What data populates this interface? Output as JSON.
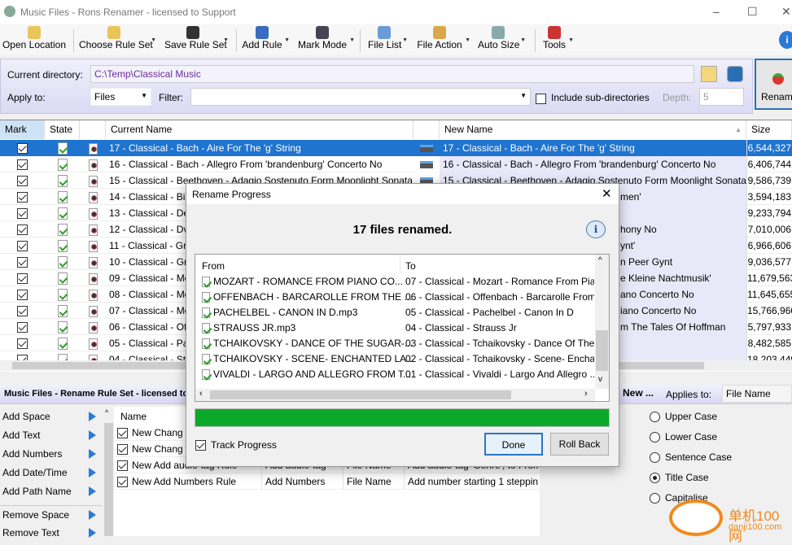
{
  "window": {
    "title": "Music Files - Rons Renamer - licensed to Support",
    "minimize": "–",
    "maximize": "☐",
    "close": "✕"
  },
  "toolbar": [
    {
      "label": "Open Location",
      "icon": "folder-icon",
      "color": "#e8c45a"
    },
    {
      "label": "Choose Rule Set",
      "icon": "folder-add-icon",
      "color": "#e8c45a"
    },
    {
      "label": "Save Rule Set",
      "icon": "save-icon",
      "color": "#333"
    },
    {
      "label": "Add Rule",
      "icon": "add-rule-icon",
      "color": "#3a6cc0"
    },
    {
      "label": "Mark Mode",
      "icon": "list-icon",
      "color": "#445"
    },
    {
      "label": "File List",
      "icon": "file-list-icon",
      "color": "#6a9ad8"
    },
    {
      "label": "File Action",
      "icon": "file-action-icon",
      "color": "#d8a84a"
    },
    {
      "label": "Auto Size",
      "icon": "auto-size-icon",
      "color": "#8aa"
    },
    {
      "label": "Tools",
      "icon": "tools-icon",
      "color": "#c33"
    }
  ],
  "directory": {
    "label": "Current directory:",
    "value": "C:\\Temp\\Classical Music",
    "apply_label": "Apply to:",
    "apply_value": "Files",
    "filter_label": "Filter:",
    "filter_value": "",
    "include_sub": "Include sub-directories",
    "depth_label": "Depth:",
    "depth_value": "5",
    "rename": "Renam"
  },
  "grid": {
    "headers": {
      "mark": "Mark",
      "state": "State",
      "current": "Current Name",
      "new": "New Name",
      "size": "Size"
    },
    "rows": [
      {
        "current": "17 - Classical - Bach - Aire For The 'g' String",
        "new": "17 - Classical - Bach - Aire For The 'g' String",
        "size": "6,544,327"
      },
      {
        "current": "16 - Classical - Bach - Allegro From 'brandenburg' Concerto No",
        "new": "16 - Classical - Bach - Allegro From 'brandenburg' Concerto No",
        "size": "6,406,744"
      },
      {
        "current": "15 - Classical - Beethoven - Adagio Sostenuto Form Moonlight Sonata",
        "new": "15 - Classical - Beethoven - Adagio Sostenuto Form Moonlight Sonata",
        "size": "9,586,739"
      },
      {
        "current": "14 - Classical - Biz",
        "new_fragment": "men'",
        "size": "3,594,183"
      },
      {
        "current": "13 - Classical - De",
        "new_fragment": "",
        "size": "9,233,794"
      },
      {
        "current": "12 - Classical - Dv",
        "new_fragment": "hony No",
        "size": "7,010,006"
      },
      {
        "current": "11 - Classical - Gri",
        "new_fragment": "ynt'",
        "size": "6,966,606"
      },
      {
        "current": "10 - Classical - Gri",
        "new_fragment": "n Peer Gynt",
        "size": "9,036,577"
      },
      {
        "current": "09 - Classical - Mo",
        "new_fragment": "e Kleine Nachtmusik'",
        "size": "11,679,563"
      },
      {
        "current": "08 - Classical - Mo",
        "new_fragment": "ano Concerto No",
        "size": "11,645,655"
      },
      {
        "current": "07 - Classical - Mo",
        "new_fragment": "iano Concerto No",
        "size": "15,766,960"
      },
      {
        "current": "06 - Classical - Off",
        "new_fragment": "m The Tales Of Hoffman",
        "size": "5,797,933"
      },
      {
        "current": "05 - Classical - Pa",
        "new_fragment": "",
        "size": "8,482,585"
      },
      {
        "current": "04 - Classical - Str",
        "new_fragment": "",
        "size": "18,203,449"
      }
    ]
  },
  "ruleset": {
    "title": "Music Files - Rename Rule Set - licensed to",
    "new_label": "New ...",
    "applies_label": "Applies to:",
    "applies_value": "File Name",
    "actions": [
      "Add Space",
      "Add Text",
      "Add Numbers",
      "Add Date/Time",
      "Add Path Name",
      "Remove Space",
      "Remove Text"
    ],
    "table_header": "Name",
    "rules": [
      {
        "name": "New Chang",
        "type": "",
        "applies": "",
        "desc": ""
      },
      {
        "name": "New Chang",
        "type": "",
        "applies": "",
        "desc": ""
      },
      {
        "name": "New Add audio-tag Rule",
        "type": "Add audio-tag",
        "applies": "File Name",
        "desc": "Add audio-tag 'Genre', to From"
      },
      {
        "name": "New Add Numbers Rule",
        "type": "Add Numbers",
        "applies": "File Name",
        "desc": "Add number starting 1 steppin"
      }
    ],
    "case_options": [
      {
        "label": "Upper Case",
        "selected": false
      },
      {
        "label": "Lower Case",
        "selected": false
      },
      {
        "label": "Sentence Case",
        "selected": false
      },
      {
        "label": "Title Case",
        "selected": true
      },
      {
        "label": "Capitalise",
        "selected": false
      }
    ]
  },
  "dialog": {
    "title": "Rename Progress",
    "close": "✕",
    "message": "17 files renamed.",
    "from_header": "From",
    "to_header": "To",
    "rows": [
      {
        "from": "MOZART - ROMANCE FROM PIANO CO...",
        "to": "07 - Classical - Mozart - Romance From Pia..."
      },
      {
        "from": "OFFENBACH - BARCAROLLE FROM THE ...",
        "to": "06 - Classical - Offenbach - Barcarolle From..."
      },
      {
        "from": "PACHELBEL - CANON IN D.mp3",
        "to": "05 - Classical - Pachelbel - Canon In D"
      },
      {
        "from": "STRAUSS JR.mp3",
        "to": "04 - Classical - Strauss Jr"
      },
      {
        "from": "TCHAIKOVSKY - DANCE OF THE SUGAR-...",
        "to": "03 - Classical - Tchaikovsky - Dance Of The ..."
      },
      {
        "from": "TCHAIKOVSKY - SCENE- ENCHANTED LA...",
        "to": "02 - Classical - Tchaikovsky - Scene- Encha..."
      },
      {
        "from": "VIVALDI - LARGO AND ALLEGRO FROM T...",
        "to": "01 - Classical - Vivaldi - Largo And Allegro ..."
      }
    ],
    "progress": 100,
    "progress_color": "#0ca82a",
    "track_progress": "Track Progress",
    "done": "Done",
    "rollback": "Roll Back"
  },
  "watermark": {
    "text": "单机100网",
    "url_text": "danji100.com"
  }
}
